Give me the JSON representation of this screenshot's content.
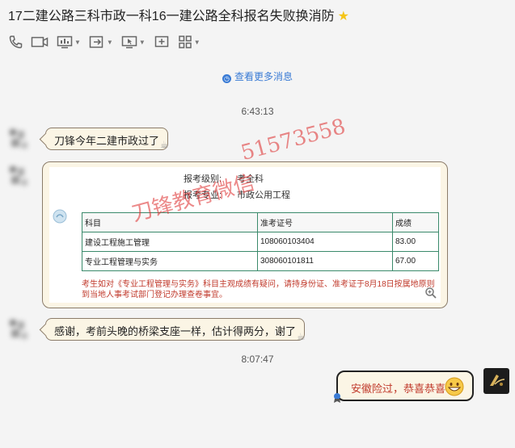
{
  "header": {
    "title": "17二建公路三科市政一科16一建公路全科报名失败换消防",
    "star_icon": "star-icon"
  },
  "toolbar": {
    "icons": [
      "phone-icon",
      "video-icon",
      "screen-share-icon",
      "file-transfer-icon",
      "remote-assist-icon",
      "whiteboard-icon",
      "apps-icon"
    ]
  },
  "view_more": {
    "label": "查看更多消息"
  },
  "times": {
    "t1": "6:43:13",
    "t2": "8:07:47"
  },
  "messages": {
    "m1": "刀锋今年二建市政过了",
    "m3": "感谢，考前头晚的桥梁支座一样，估计得两分，谢了",
    "m4": "安徽险过，恭喜恭喜"
  },
  "card": {
    "level_label": "报考级别:",
    "level_value": "考全科",
    "major_label": "报考专业:",
    "major_value": "市政公用工程",
    "table_headers": [
      "科目",
      "准考证号",
      "成绩"
    ],
    "rows": [
      [
        "建设工程施工管理",
        "108060103404",
        "83.00"
      ],
      [
        "专业工程管理与实务",
        "308060101811",
        "67.00"
      ]
    ],
    "notice": "考生如对《专业工程管理与实务》科目主观成绩有疑问，请持身份证、准考证于8月18日按属地原则到当地人事考试部门登记办理查卷事宜。"
  },
  "watermark": {
    "top": "51573558",
    "bottom": "刀锋教育微信"
  },
  "colors": {
    "bubble_bg": "#fbf5e5",
    "link": "#3a7bd5",
    "notice": "#c0392b",
    "table_border": "#3a8a6b"
  }
}
